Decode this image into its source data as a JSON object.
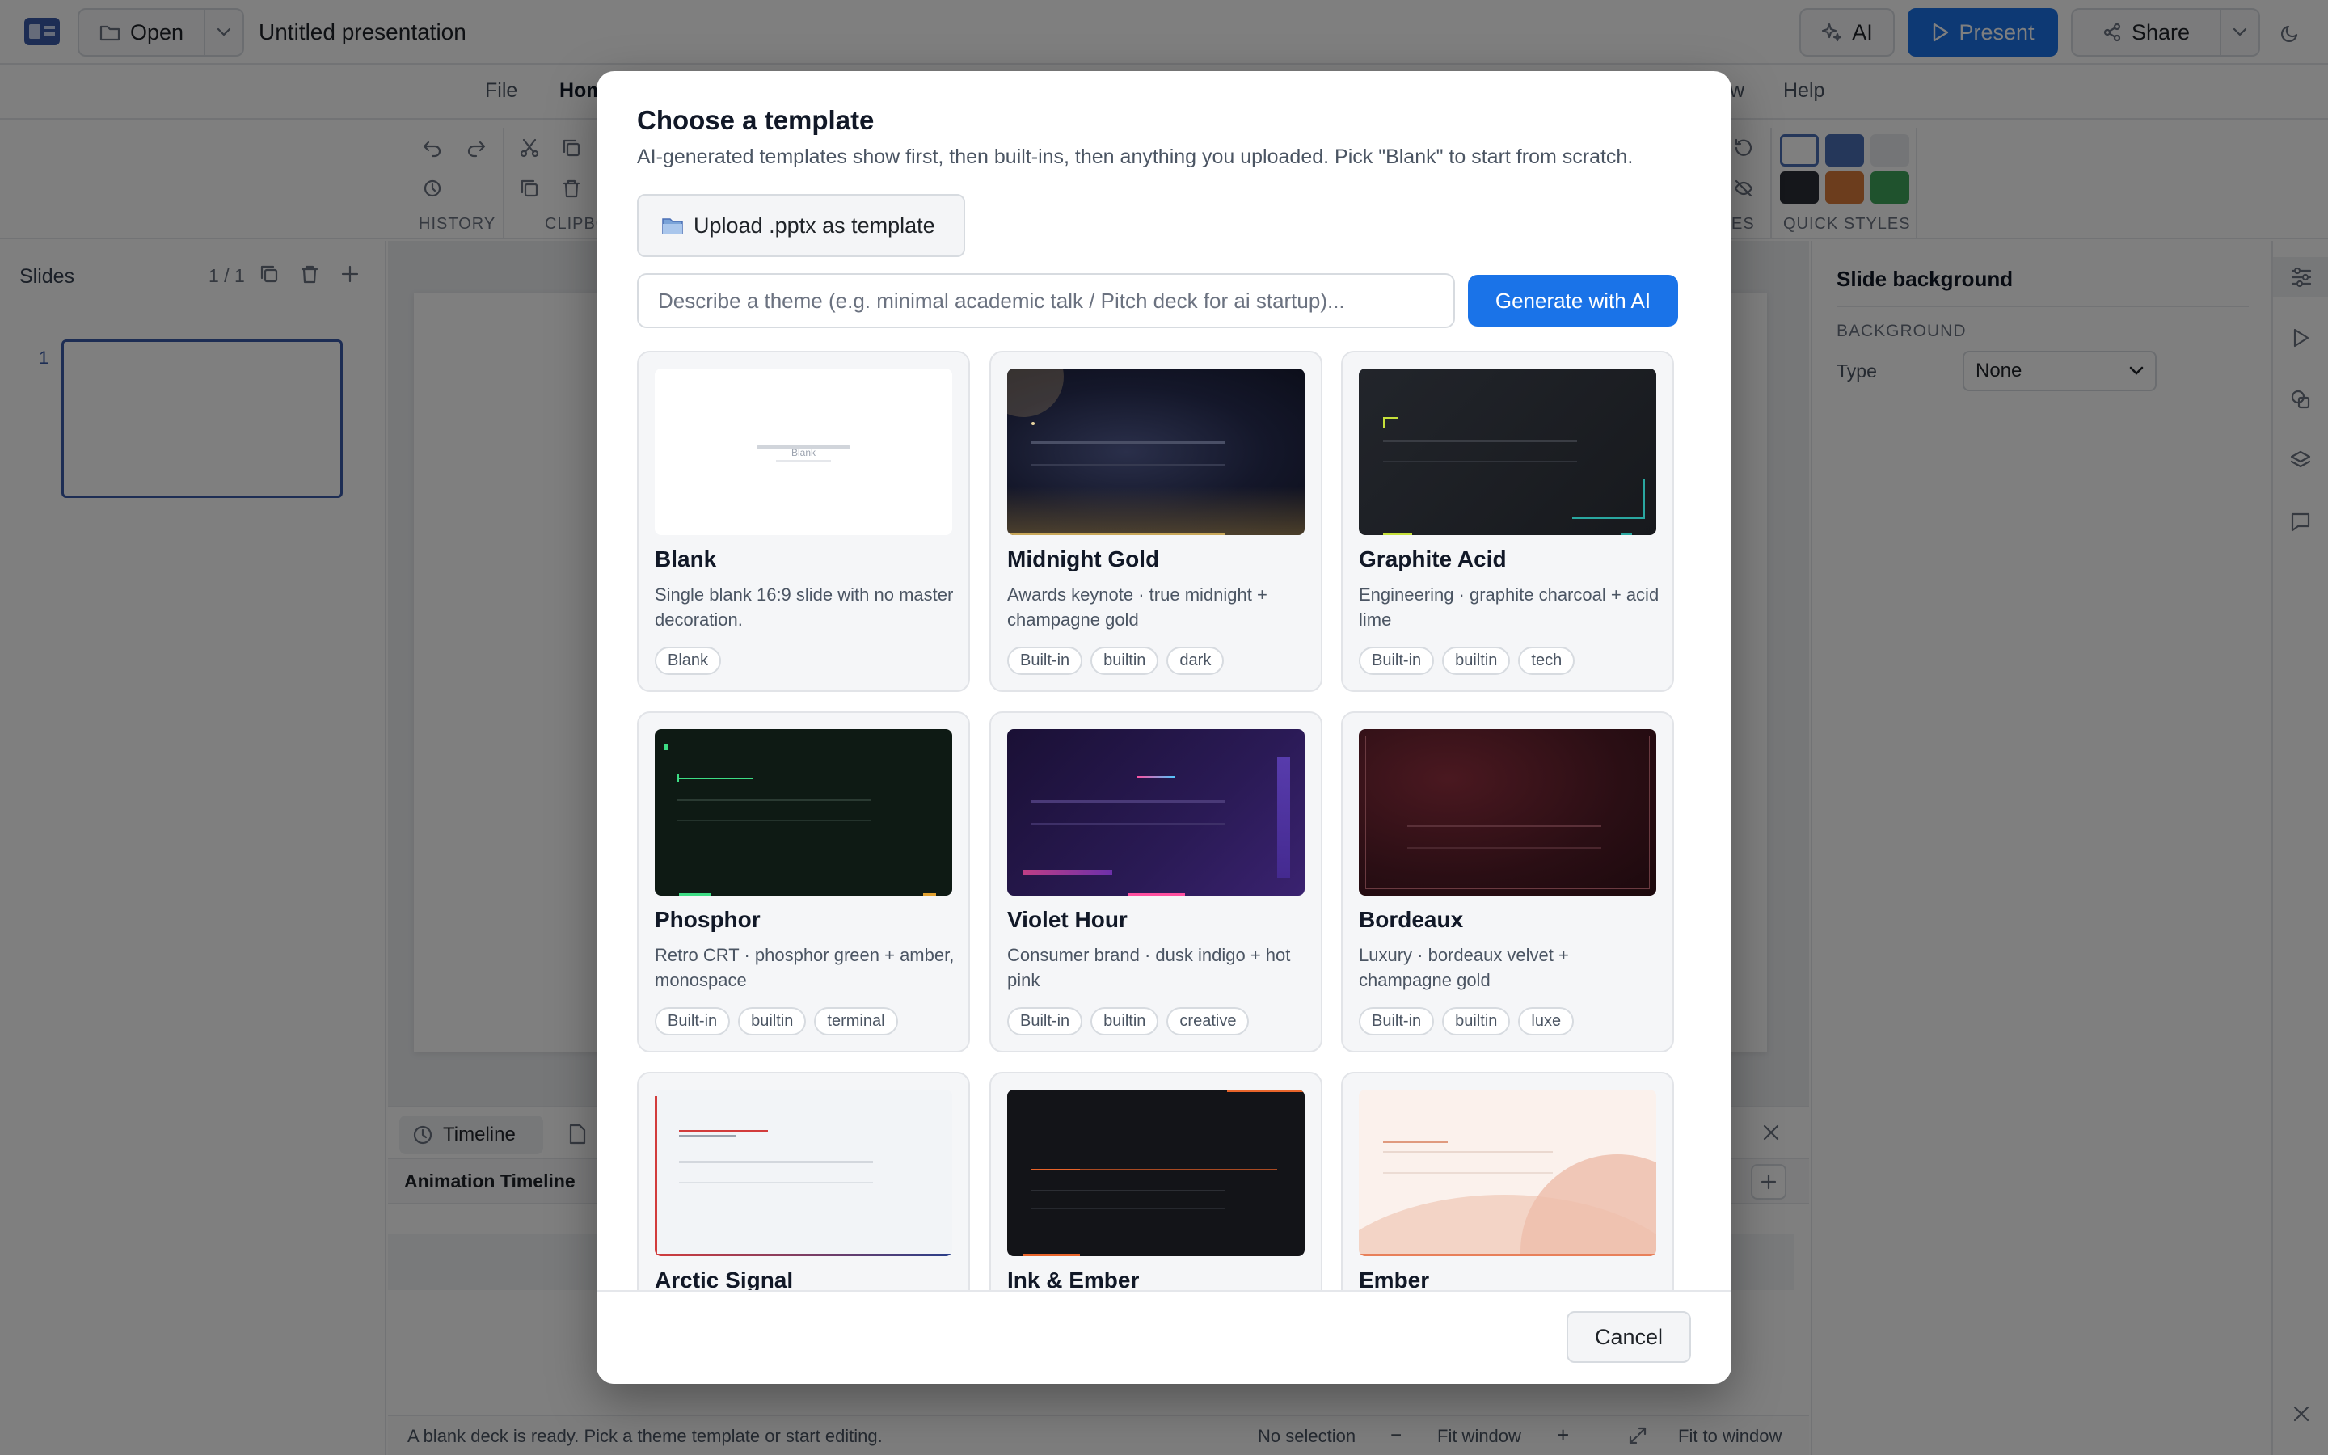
{
  "topbar": {
    "open_label": "Open",
    "doc_title": "Untitled presentation",
    "ai_label": "AI",
    "present_label": "Present",
    "share_label": "Share"
  },
  "tabs": [
    "File",
    "Home",
    "w",
    "Help"
  ],
  "ribbon": {
    "groups": [
      "HISTORY",
      "CLIPBO",
      "ES",
      "QUICK STYLES"
    ],
    "quick_styles": [
      "#ffffff",
      "#4a6fb5",
      "#eef0f3",
      "#2b2f36",
      "#d97a3a",
      "#3fa55b"
    ]
  },
  "slides_panel": {
    "title": "Slides",
    "count": "1 / 1",
    "slide_number": "1"
  },
  "right_panel": {
    "title": "Slide background",
    "section": "BACKGROUND",
    "type_label": "Type",
    "type_value": "None"
  },
  "timeline": {
    "tab_label": "Timeline",
    "heading": "Animation Timeline"
  },
  "status": {
    "message": "A blank deck is ready. Pick a theme template or start editing.",
    "selection": "No selection",
    "zoom_label": "Fit window",
    "fit_label": "Fit to window"
  },
  "modal": {
    "title": "Choose a template",
    "subtitle": "AI-generated templates show first, then built-ins, then anything you uploaded. Pick \"Blank\" to start from scratch.",
    "upload_label": "Upload .pptx as template",
    "theme_placeholder": "Describe a theme (e.g. minimal academic talk / Pitch deck for ai startup)...",
    "generate_label": "Generate with AI",
    "cancel_label": "Cancel",
    "blank_thumb_text": "Blank",
    "templates": [
      {
        "name": "Blank",
        "desc": "Single blank 16:9 slide with no master decoration.",
        "tags": [
          "Blank"
        ]
      },
      {
        "name": "Midnight Gold",
        "desc": "Awards keynote · true midnight + champagne gold",
        "tags": [
          "Built-in",
          "builtin",
          "dark"
        ]
      },
      {
        "name": "Graphite Acid",
        "desc": "Engineering · graphite charcoal + acid lime",
        "tags": [
          "Built-in",
          "builtin",
          "tech"
        ]
      },
      {
        "name": "Phosphor",
        "desc": "Retro CRT · phosphor green + amber, monospace",
        "tags": [
          "Built-in",
          "builtin",
          "terminal"
        ]
      },
      {
        "name": "Violet Hour",
        "desc": "Consumer brand · dusk indigo + hot pink",
        "tags": [
          "Built-in",
          "builtin",
          "creative"
        ]
      },
      {
        "name": "Bordeaux",
        "desc": "Luxury · bordeaux velvet + champagne gold",
        "tags": [
          "Built-in",
          "builtin",
          "luxe"
        ]
      },
      {
        "name": "Arctic Signal",
        "desc": "",
        "tags": []
      },
      {
        "name": "Ink & Ember",
        "desc": "",
        "tags": []
      },
      {
        "name": "Ember",
        "desc": "",
        "tags": []
      }
    ]
  }
}
